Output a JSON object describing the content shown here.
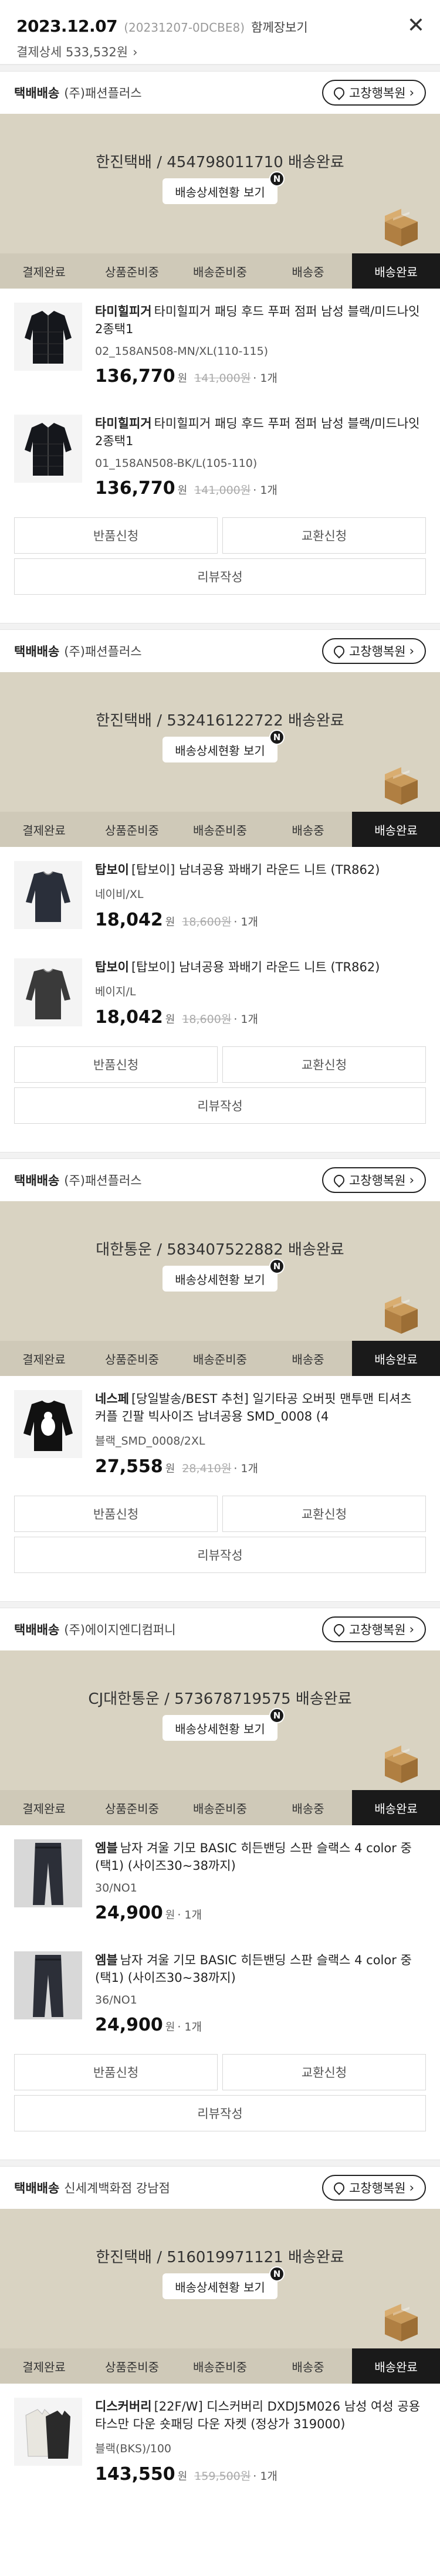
{
  "order": {
    "date": "2023.12.07",
    "order_no": "(20231207-0DCBE8)",
    "show_all": "함께장보기",
    "total_label": "결제상세 533,532원"
  },
  "common": {
    "return_address": "고창행복원",
    "track_button": "배송상세현황 보기",
    "new_badge": "N",
    "return_request": "반품신청",
    "exchange_request": "교환신청",
    "review": "리뷰작성",
    "won": "원",
    "steps": [
      "결제완료",
      "상품준비중",
      "배송준비중",
      "배송중",
      "배송완료"
    ]
  },
  "groups": [
    {
      "type": "택배배송",
      "seller": "(주)패션플러스",
      "tracking": "한진택배 / 454798011710 배송완료",
      "products": [
        {
          "brand": "타미힐피거",
          "name": "타미힐피거 패딩 후드 푸퍼 점퍼 남성 블랙/미드나잇 2종택1",
          "option": "02_158AN508-MN/XL(110-115)",
          "price": "136,770",
          "orig": "141,000원",
          "qty": "· 1개"
        },
        {
          "brand": "타미힐피거",
          "name": "타미힐피거 패딩 후드 푸퍼 점퍼 남성 블랙/미드나잇 2종택1",
          "option": "01_158AN508-BK/L(105-110)",
          "price": "136,770",
          "orig": "141,000원",
          "qty": "· 1개"
        }
      ]
    },
    {
      "type": "택배배송",
      "seller": "(주)패션플러스",
      "tracking": "한진택배 / 532416122722 배송완료",
      "products": [
        {
          "brand": "탑보이",
          "name": "[탑보이] 남녀공용 꽈배기 라운드 니트 (TR862)",
          "option": "네이비/XL",
          "price": "18,042",
          "orig": "18,600원",
          "qty": "· 1개"
        },
        {
          "brand": "탑보이",
          "name": "[탑보이] 남녀공용 꽈배기 라운드 니트 (TR862)",
          "option": "베이지/L",
          "price": "18,042",
          "orig": "18,600원",
          "qty": "· 1개"
        }
      ]
    },
    {
      "type": "택배배송",
      "seller": "(주)패션플러스",
      "tracking": "대한통운 / 583407522882 배송완료",
      "products": [
        {
          "brand": "네스페",
          "name": "[당일발송/BEST 추천] 일기타공 오버핏 맨투맨 티셔츠 커플 긴팔 빅사이즈 남녀공용 SMD_0008 (4",
          "option": "블랙_SMD_0008/2XL",
          "price": "27,558",
          "orig": "28,410원",
          "qty": "· 1개"
        }
      ]
    },
    {
      "type": "택배배송",
      "seller": "(주)에이지엔디컴퍼니",
      "tracking": "CJ대한통운 / 573678719575 배송완료",
      "products": [
        {
          "brand": "엠블",
          "name": "남자 겨울 기모 BASIC 히든밴딩 스판 슬랙스 4 color 중 (택1) (사이즈30~38까지)",
          "option": "30/NO1",
          "price": "24,900",
          "orig": "",
          "qty": "· 1개"
        },
        {
          "brand": "엠블",
          "name": "남자 겨울 기모 BASIC 히든밴딩 스판 슬랙스 4 color 중 (택1) (사이즈30~38까지)",
          "option": "36/NO1",
          "price": "24,900",
          "orig": "",
          "qty": "· 1개"
        }
      ]
    },
    {
      "type": "택배배송",
      "seller": "신세계백화점 강남점",
      "tracking": "한진택배 / 516019971121 배송완료",
      "products": [
        {
          "brand": "디스커버리",
          "name": "[22F/W] 디스커버리 DXDJ5M026 남성 여성 공용 타스만 다운 숏패딩 다운 자켓 (정상가 319000)",
          "option": "블랙(BKS)/100",
          "price": "143,550",
          "orig": "159,500원",
          "qty": "· 1개"
        }
      ]
    }
  ]
}
